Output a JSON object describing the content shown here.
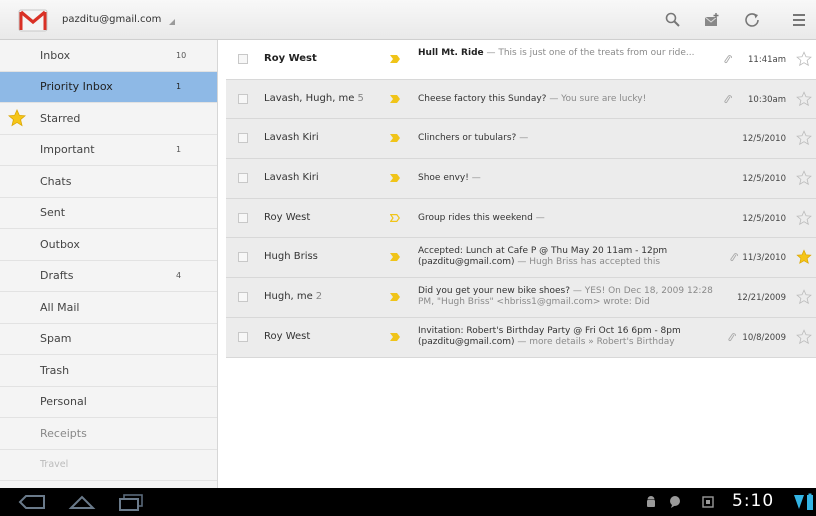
{
  "header": {
    "account": "pazditu@gmail.com"
  },
  "sidebar": {
    "items": [
      {
        "label": "Inbox",
        "count": "10"
      },
      {
        "label": "Priority Inbox",
        "count": "1"
      },
      {
        "label": "Starred",
        "count": ""
      },
      {
        "label": "Important",
        "count": "1"
      },
      {
        "label": "Chats",
        "count": ""
      },
      {
        "label": "Sent",
        "count": ""
      },
      {
        "label": "Outbox",
        "count": ""
      },
      {
        "label": "Drafts",
        "count": "4"
      },
      {
        "label": "All Mail",
        "count": ""
      },
      {
        "label": "Spam",
        "count": ""
      },
      {
        "label": "Trash",
        "count": ""
      },
      {
        "label": "Personal",
        "count": ""
      },
      {
        "label": "Receipts",
        "count": ""
      },
      {
        "label": "Travel",
        "count": ""
      }
    ]
  },
  "messages": [
    {
      "sender": "Roy West",
      "thread_count": "",
      "subject": "Hull Mt. Ride",
      "snippet": " — This is just one of the treats from our ride...",
      "date": "11:41am",
      "attachment": true,
      "starred": false,
      "unread": true
    },
    {
      "sender": "Lavash, Hugh, me",
      "thread_count": "5",
      "subject": "Cheese factory this Sunday?",
      "snippet": " — You sure are lucky!",
      "date": "10:30am",
      "attachment": true,
      "starred": false,
      "unread": false
    },
    {
      "sender": "Lavash Kiri",
      "thread_count": "",
      "subject": "Clinchers or tubulars?",
      "snippet": " —",
      "date": "12/5/2010",
      "attachment": false,
      "starred": false,
      "unread": false
    },
    {
      "sender": "Lavash Kiri",
      "thread_count": "",
      "subject": "Shoe envy!",
      "snippet": " —",
      "date": "12/5/2010",
      "attachment": false,
      "starred": false,
      "unread": false
    },
    {
      "sender": "Roy West",
      "thread_count": "",
      "subject": "Group rides this weekend",
      "snippet": " —",
      "date": "12/5/2010",
      "attachment": false,
      "starred": false,
      "unread": false
    },
    {
      "sender": "Hugh Briss",
      "thread_count": "",
      "subject": "Accepted: Lunch at Cafe P @ Thu May 20 11am - 12pm (pazditu@gmail.com)",
      "snippet": " — Hugh Briss has accepted this",
      "date": "11/3/2010",
      "attachment": true,
      "starred": true,
      "unread": false
    },
    {
      "sender": "Hugh, me",
      "thread_count": "2",
      "subject": "Did you get your new bike shoes?",
      "snippet": " — YES! On Dec 18, 2009 12:28 PM, \"Hugh Briss\" <hbriss1@gmail.com> wrote: Did",
      "date": "12/21/2009",
      "attachment": false,
      "starred": false,
      "unread": false
    },
    {
      "sender": "Roy West",
      "thread_count": "",
      "subject": "Invitation: Robert's Birthday Party @ Fri Oct 16 6pm - 8pm (pazditu@gmail.com)",
      "snippet": " — more details » Robert's Birthday",
      "date": "10/8/2009",
      "attachment": true,
      "starred": false,
      "unread": false
    }
  ],
  "system": {
    "time": "5:10"
  },
  "colors": {
    "selected_folder": "#8eb9e6",
    "importance_marker": "#f0c419",
    "star": "#f5c518",
    "gmail_red": "#d93025"
  }
}
